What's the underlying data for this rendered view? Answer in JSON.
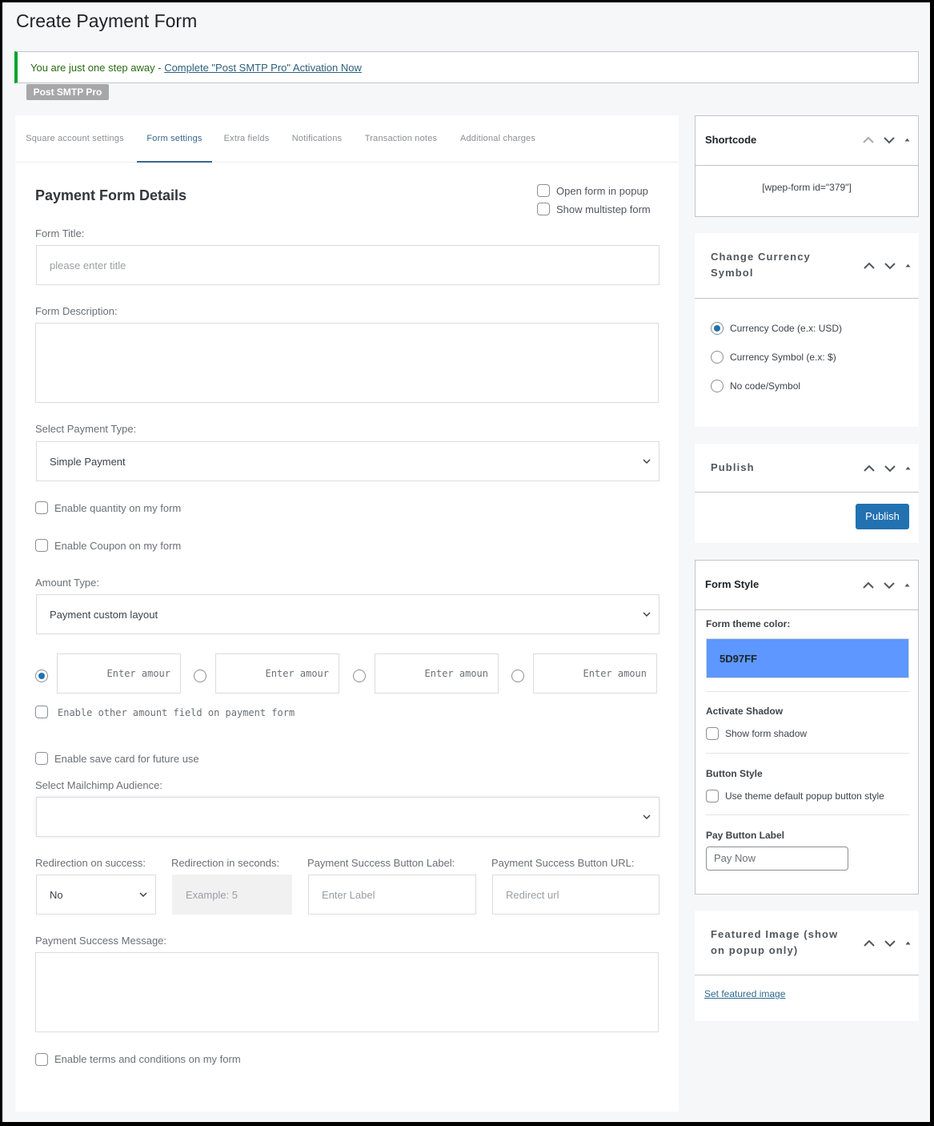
{
  "page": {
    "title": "Create Payment Form"
  },
  "notice": {
    "text": "You are just one step away - ",
    "link": "Complete \"Post SMTP Pro\" Activation Now",
    "accent": "#00a32a"
  },
  "badge": "Post SMTP Pro",
  "tabs": [
    {
      "label": "Square account settings",
      "active": false
    },
    {
      "label": "Form settings",
      "active": true
    },
    {
      "label": "Extra fields",
      "active": false
    },
    {
      "label": "Notifications",
      "active": false
    },
    {
      "label": "Transaction notes",
      "active": false
    },
    {
      "label": "Additional charges",
      "active": false
    }
  ],
  "form": {
    "section_title": "Payment Form Details",
    "open_popup": {
      "label": "Open form in popup",
      "checked": false
    },
    "multistep": {
      "label": "Show multistep form",
      "checked": false
    },
    "title_label": "Form Title:",
    "title_placeholder": "please enter title",
    "title_value": "",
    "description_label": "Form Description:",
    "description_value": "",
    "payment_type_label": "Select Payment Type:",
    "payment_type_value": "Simple Payment",
    "enable_quantity": {
      "label": "Enable quantity on my form",
      "checked": false
    },
    "enable_coupon": {
      "label": "Enable Coupon on my form",
      "checked": false
    },
    "amount_type_label": "Amount Type:",
    "amount_type_value": "Payment custom layout",
    "amounts": [
      {
        "placeholder": "Enter amour",
        "selected": true
      },
      {
        "placeholder": "Enter amour",
        "selected": false
      },
      {
        "placeholder": "Enter amoun",
        "selected": false
      },
      {
        "placeholder": "Enter amoun",
        "selected": false
      }
    ],
    "other_amount": {
      "label": "Enable other amount field on payment form",
      "checked": false
    },
    "save_card": {
      "label": "Enable save card for future use",
      "checked": false
    },
    "mailchimp_label": "Select Mailchimp Audience:",
    "mailchimp_value": "",
    "redirection_label": "Redirection on success:",
    "redirection_value": "No",
    "redirection_seconds_label": "Redirection in seconds:",
    "redirection_seconds_placeholder": "Example: 5",
    "success_btn_label_label": "Payment Success Button Label:",
    "success_btn_label_placeholder": "Enter Label",
    "success_btn_url_label": "Payment Success Button URL:",
    "success_btn_url_placeholder": "Redirect url",
    "success_message_label": "Payment Success Message:",
    "success_message_value": "",
    "terms": {
      "label": "Enable terms and conditions on my form",
      "checked": false
    }
  },
  "sidebar": {
    "shortcode": {
      "title": "Shortcode",
      "value": "[wpep-form id=\"379\"]"
    },
    "currency": {
      "title_line1": "Change Currency",
      "title_line2": "Symbol",
      "options": [
        {
          "label": "Currency Code (e.x: USD)",
          "selected": true
        },
        {
          "label": "Currency Symbol (e.x: $)",
          "selected": false
        },
        {
          "label": "No code/Symbol",
          "selected": false
        }
      ]
    },
    "publish": {
      "title": "Publish",
      "button": "Publish"
    },
    "form_style": {
      "title": "Form Style",
      "theme_color_label": "Form theme color:",
      "theme_color_value": "5D97FF",
      "theme_color_hex": "#5d97ff",
      "shadow_heading": "Activate Shadow",
      "shadow": {
        "label": "Show form shadow",
        "checked": false
      },
      "button_style_heading": "Button Style",
      "button_style": {
        "label": "Use theme default popup button style",
        "checked": false
      },
      "pay_label_heading": "Pay Button Label",
      "pay_label_placeholder": "Pay Now"
    },
    "featured": {
      "title_line1": "Featured Image (show",
      "title_line2": "on popup only)",
      "link": "Set featured image"
    }
  }
}
